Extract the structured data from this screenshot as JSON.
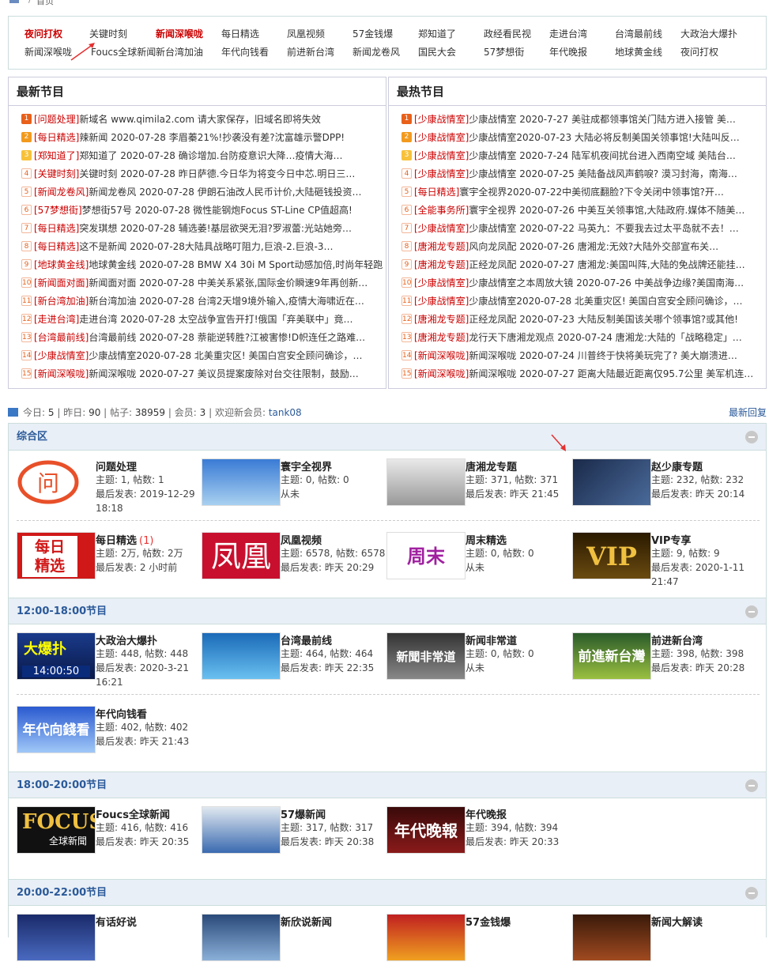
{
  "breadcrumb": {
    "label": "首页"
  },
  "topnav": {
    "row1": [
      {
        "t": "夜问打权",
        "red": true
      },
      {
        "t": "关键时刻",
        "red": false
      },
      {
        "t": "新闻深喉咙",
        "red": true
      },
      {
        "t": "每日精选",
        "red": false
      },
      {
        "t": "凤凰视频",
        "red": false
      },
      {
        "t": "57金钱爆",
        "red": false
      },
      {
        "t": "郑知道了",
        "red": false
      },
      {
        "t": "政经看民视",
        "red": false
      },
      {
        "t": "走进台湾",
        "red": false
      },
      {
        "t": "台湾最前线",
        "red": false
      },
      {
        "t": "大政治大爆扑",
        "red": false
      }
    ],
    "row2": [
      {
        "t": "新闻深喉咙",
        "red": false
      },
      {
        "t": "Foucs全球新闻",
        "red": false
      },
      {
        "t": "新台湾加油",
        "red": false
      },
      {
        "t": "年代向钱看",
        "red": false
      },
      {
        "t": "前进新台湾",
        "red": false
      },
      {
        "t": "新闻龙卷风",
        "red": false
      },
      {
        "t": "国民大会",
        "red": false
      },
      {
        "t": "57梦想街",
        "red": false
      },
      {
        "t": "年代晚报",
        "red": false
      },
      {
        "t": "地球黄金线",
        "red": false
      },
      {
        "t": "夜问打权",
        "red": false
      }
    ]
  },
  "latest": {
    "title": "最新节目",
    "items": [
      {
        "n": "1",
        "tag": "[问题处理]",
        "t": "新域名 www.qimila2.com 请大家保存，旧域名即将失效"
      },
      {
        "n": "2",
        "tag": "[每日精选]",
        "t": "辣新闻 2020-07-28 李眉蓁21%!抄袭没有差?沈富雄示警DPP!"
      },
      {
        "n": "3",
        "tag": "[郑知道了]",
        "t": "郑知道了 2020-07-28 确诊增加.台防疫意识大降…疫情大海…"
      },
      {
        "n": "4",
        "tag": "[关键时刻]",
        "t": "关键时刻 2020-07-28 昨日萨德.今日华为将变今日中芯.明日三…"
      },
      {
        "n": "5",
        "tag": "[新闻龙卷风]",
        "t": "新闻龙卷风 2020-07-28 伊朗石油改人民币计价,大陆砸钱投资…"
      },
      {
        "n": "6",
        "tag": "[57梦想街]",
        "t": "梦想街57号 2020-07-28 微性能钢炮Focus ST-Line CP值超高!"
      },
      {
        "n": "7",
        "tag": "[每日精选]",
        "t": "突发琪想 2020-07-28 辅选萎!基层欲哭无泪?罗淑蕾:光站她旁…"
      },
      {
        "n": "8",
        "tag": "[每日精选]",
        "t": "这不是新闻 2020-07-28大陆具战略叮阻力,巨浪-2.巨浪-3…"
      },
      {
        "n": "9",
        "tag": "[地球黄金线]",
        "t": "地球黄金线 2020-07-28 BMW X4 30i M Sport动感加倍,时尚年轻跑"
      },
      {
        "n": "10",
        "tag": "[新闻面对面]",
        "t": "新闻面对面 2020-07-28 中美关系紧张,国际金价瞬速9年再创新…"
      },
      {
        "n": "11",
        "tag": "[新台湾加油]",
        "t": "新台湾加油 2020-07-28 台湾2天增9境外输入,疫情大海啸近在…"
      },
      {
        "n": "12",
        "tag": "[走进台湾]",
        "t": "走进台湾 2020-07-28 太空战争宣告开打!俄国「弃美联中」竟…"
      },
      {
        "n": "13",
        "tag": "[台湾最前线]",
        "t": "台湾最前线 2020-07-28 萘能逆转胜?江被害惨!D帜连任之路难…"
      },
      {
        "n": "14",
        "tag": "[少康战情室]",
        "t": "少康战情室2020-07-28 北美重灾区! 美国白宫安全顾问确诊，…"
      },
      {
        "n": "15",
        "tag": "[新闻深喉咙]",
        "t": "新闻深喉咙 2020-07-27 美议员提案废除对台交往限制，鼓励…"
      }
    ]
  },
  "hottest": {
    "title": "最热节目",
    "items": [
      {
        "n": "1",
        "tag": "[少康战情室]",
        "t": "少康战情室 2020-7-27 美驻成都领事馆关门陆方进入接管 美…"
      },
      {
        "n": "2",
        "tag": "[少康战情室]",
        "t": "少康战情室2020-07-23 大陆必将反制美国关领事馆!大陆叫反…"
      },
      {
        "n": "3",
        "tag": "[少康战情室]",
        "t": "少康战情室 2020-7-24 陆军机夜间扰台进入西南空域 美陆台…"
      },
      {
        "n": "4",
        "tag": "[少康战情室]",
        "t": "少康战情室 2020-07-25 美陆备战风声鹤唳? 漠习封海，南海…"
      },
      {
        "n": "5",
        "tag": "[每日精选]",
        "t": "寰宇全视界2020-07-22中美彻底翻脸?下令关闭中领事馆?开…"
      },
      {
        "n": "6",
        "tag": "[全能事务所]",
        "t": "寰宇全视界 2020-07-26 中美互关领事馆,大陆政府.媒体不随美…"
      },
      {
        "n": "7",
        "tag": "[少康战情室]",
        "t": "少康战情室 2020-07-22 马英九：不要我去过太平岛就不去！…"
      },
      {
        "n": "8",
        "tag": "[唐湘龙专题]",
        "t": "风向龙凤配 2020-07-26 唐湘龙:无效?大陆外交部宣布关…"
      },
      {
        "n": "9",
        "tag": "[唐湘龙专题]",
        "t": "正经龙凤配 2020-07-27 唐湘龙:美国叫阵,大陆的免战牌还能挂…"
      },
      {
        "n": "10",
        "tag": "[少康战情室]",
        "t": "少康战情室之本周放大镜 2020-07-26 中美战争边缘?美国南海…"
      },
      {
        "n": "11",
        "tag": "[少康战情室]",
        "t": "少康战情室2020-07-28 北美重灾区! 美国白宫安全顾问确诊，…"
      },
      {
        "n": "12",
        "tag": "[唐湘龙专题]",
        "t": "正经龙凤配 2020-07-23 大陆反制美国该关哪个领事馆?或其他!"
      },
      {
        "n": "13",
        "tag": "[唐湘龙专题]",
        "t": "龙行天下唐湘龙观点 2020-07-24 唐湘龙:大陆的「战略稳定」…"
      },
      {
        "n": "14",
        "tag": "[新闻深喉咙]",
        "t": "新闻深喉咙 2020-07-24 川普终于快将美玩完了? 美大崩溃进…"
      },
      {
        "n": "15",
        "tag": "[新闻深喉咙]",
        "t": "新闻深喉咙 2020-07-27 距离大陆最近距离仅95.7公里 美军机连…"
      }
    ]
  },
  "stats": {
    "today_l": "今日:",
    "today": "5",
    "yest_l": "昨日:",
    "yest": "90",
    "posts_l": "帖子:",
    "posts": "38959",
    "members_l": "会员:",
    "members": "3",
    "welcome": "欢迎新会员:",
    "newmember": "tank08",
    "newreplies": "最新回复"
  },
  "sections": [
    {
      "title": "综合区",
      "rows": [
        [
          {
            "name": "问题处理",
            "badge": "",
            "l1": "主题: 1, 帖数: 1",
            "l2": "最后发表: 2019-12-29 18:18",
            "img": "wen"
          },
          {
            "name": "寰宇全视界",
            "badge": "",
            "l1": "主题: 0, 帖数: 0",
            "l2": "从未",
            "img": "hq"
          },
          {
            "name": "唐湘龙专题",
            "badge": "",
            "l1": "主题: 371, 帖数: 371",
            "l2": "最后发表: 昨天 21:45",
            "img": "tang"
          },
          {
            "name": "赵少康专题",
            "badge": "",
            "l1": "主题: 232, 帖数: 232",
            "l2": "最后发表: 昨天 20:14",
            "img": "zhao"
          }
        ],
        [
          {
            "name": "每日精选",
            "badge": "(1)",
            "l1": "主题: 2万, 帖数: 2万",
            "l2": "最后发表: 2 小时前",
            "img": "mrjx"
          },
          {
            "name": "凤凰视频",
            "badge": "",
            "l1": "主题: 6578, 帖数: 6578",
            "l2": "最后发表: 昨天 20:29",
            "img": "fh"
          },
          {
            "name": "周末精选",
            "badge": "",
            "l1": "主题: 0, 帖数: 0",
            "l2": "从未",
            "img": "zm"
          },
          {
            "name": "VIP专享",
            "badge": "",
            "l1": "主题: 9, 帖数: 9",
            "l2": "最后发表: 2020-1-11 21:47",
            "img": "vip"
          }
        ]
      ]
    },
    {
      "title": "12:00-18:00节目",
      "rows": [
        [
          {
            "name": "大政治大爆扑",
            "badge": "",
            "l1": "主题: 448, 帖数: 448",
            "l2": "最后发表: 2020-3-21 16:21",
            "img": "dbp"
          },
          {
            "name": "台湾最前线",
            "badge": "",
            "l1": "主题: 464, 帖数: 464",
            "l2": "最后发表: 昨天 22:35",
            "img": "tw"
          },
          {
            "name": "新闻非常道",
            "badge": "",
            "l1": "主题: 0, 帖数: 0",
            "l2": "从未",
            "img": "xw"
          },
          {
            "name": "前进新台湾",
            "badge": "",
            "l1": "主题: 398, 帖数: 398",
            "l2": "最后发表: 昨天 20:28",
            "img": "qj"
          }
        ],
        [
          {
            "name": "年代向钱看",
            "badge": "",
            "l1": "主题: 402, 帖数: 402",
            "l2": "最后发表: 昨天 21:43",
            "img": "nd"
          }
        ]
      ]
    },
    {
      "title": "18:00-20:00节目",
      "rows": [
        [
          {
            "name": "Foucs全球新闻",
            "badge": "",
            "l1": "主题: 416, 帖数: 416",
            "l2": "最后发表: 昨天 20:35",
            "img": "focus"
          },
          {
            "name": "57爆新闻",
            "badge": "",
            "l1": "主题: 317, 帖数: 317",
            "l2": "最后发表: 昨天 20:38",
            "img": "b57"
          },
          {
            "name": "年代晚报",
            "badge": "",
            "l1": "主题: 394, 帖数: 394",
            "l2": "最后发表: 昨天 20:33",
            "img": "wb"
          }
        ]
      ]
    },
    {
      "title": "20:00-22:00节目",
      "rows": [
        [
          {
            "name": "有话好说",
            "badge": "",
            "l1": "",
            "l2": "",
            "img": "yh"
          },
          {
            "name": "新欣说新闻",
            "badge": "",
            "l1": "",
            "l2": "",
            "img": "xx"
          },
          {
            "name": "57金钱爆",
            "badge": "",
            "l1": "",
            "l2": "",
            "img": "jq"
          },
          {
            "name": "新闻大解读",
            "badge": "",
            "l1": "",
            "l2": "",
            "img": "dj"
          }
        ]
      ]
    }
  ]
}
